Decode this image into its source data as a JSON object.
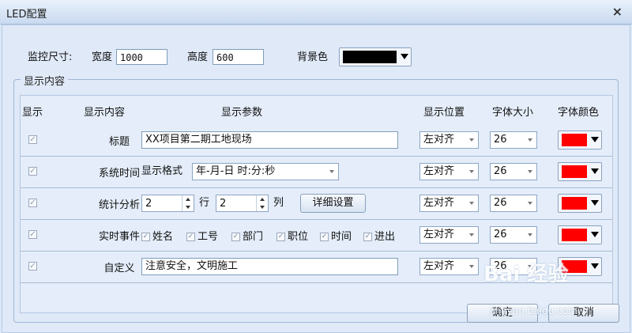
{
  "window": {
    "title": "LED配置",
    "close": "×"
  },
  "monitor": {
    "label": "监控尺寸:",
    "width_label": "宽度",
    "width_value": "1000",
    "height_label": "高度",
    "height_value": "600",
    "bg_label": "背景色",
    "bg_color": "#000000"
  },
  "group": {
    "title": "显示内容"
  },
  "headers": {
    "show": "显示",
    "content": "显示内容",
    "params": "显示参数",
    "position": "显示位置",
    "size": "字体大小",
    "color": "字体颜色"
  },
  "rows": [
    {
      "name": "标题",
      "text": "XX项目第二期工地现场",
      "position": "左对齐",
      "size": "26",
      "color": "#ff0000"
    },
    {
      "name": "系统时间",
      "format_label": "显示格式",
      "format_value": "年-月-日 时:分:秒",
      "position": "左对齐",
      "size": "26",
      "color": "#ff0000"
    },
    {
      "name": "统计分析",
      "rows_value": "2",
      "rows_label": "行",
      "cols_value": "2",
      "cols_label": "列",
      "detail_button": "详细设置",
      "position": "左对齐",
      "size": "26",
      "color": "#ff0000"
    },
    {
      "name": "实时事件",
      "items": [
        "姓名",
        "工号",
        "部门",
        "职位",
        "时间",
        "进出"
      ],
      "position": "左对齐",
      "size": "26",
      "color": "#ff0000"
    },
    {
      "name": "自定义",
      "text": "注意安全，文明施工",
      "position": "左对齐",
      "size": "26",
      "color": "#ff0000"
    }
  ],
  "buttons": {
    "ok": "确定",
    "cancel": "取消"
  },
  "watermark": {
    "text": "Bai 经验",
    "url": "jingyan.baidu.com"
  }
}
